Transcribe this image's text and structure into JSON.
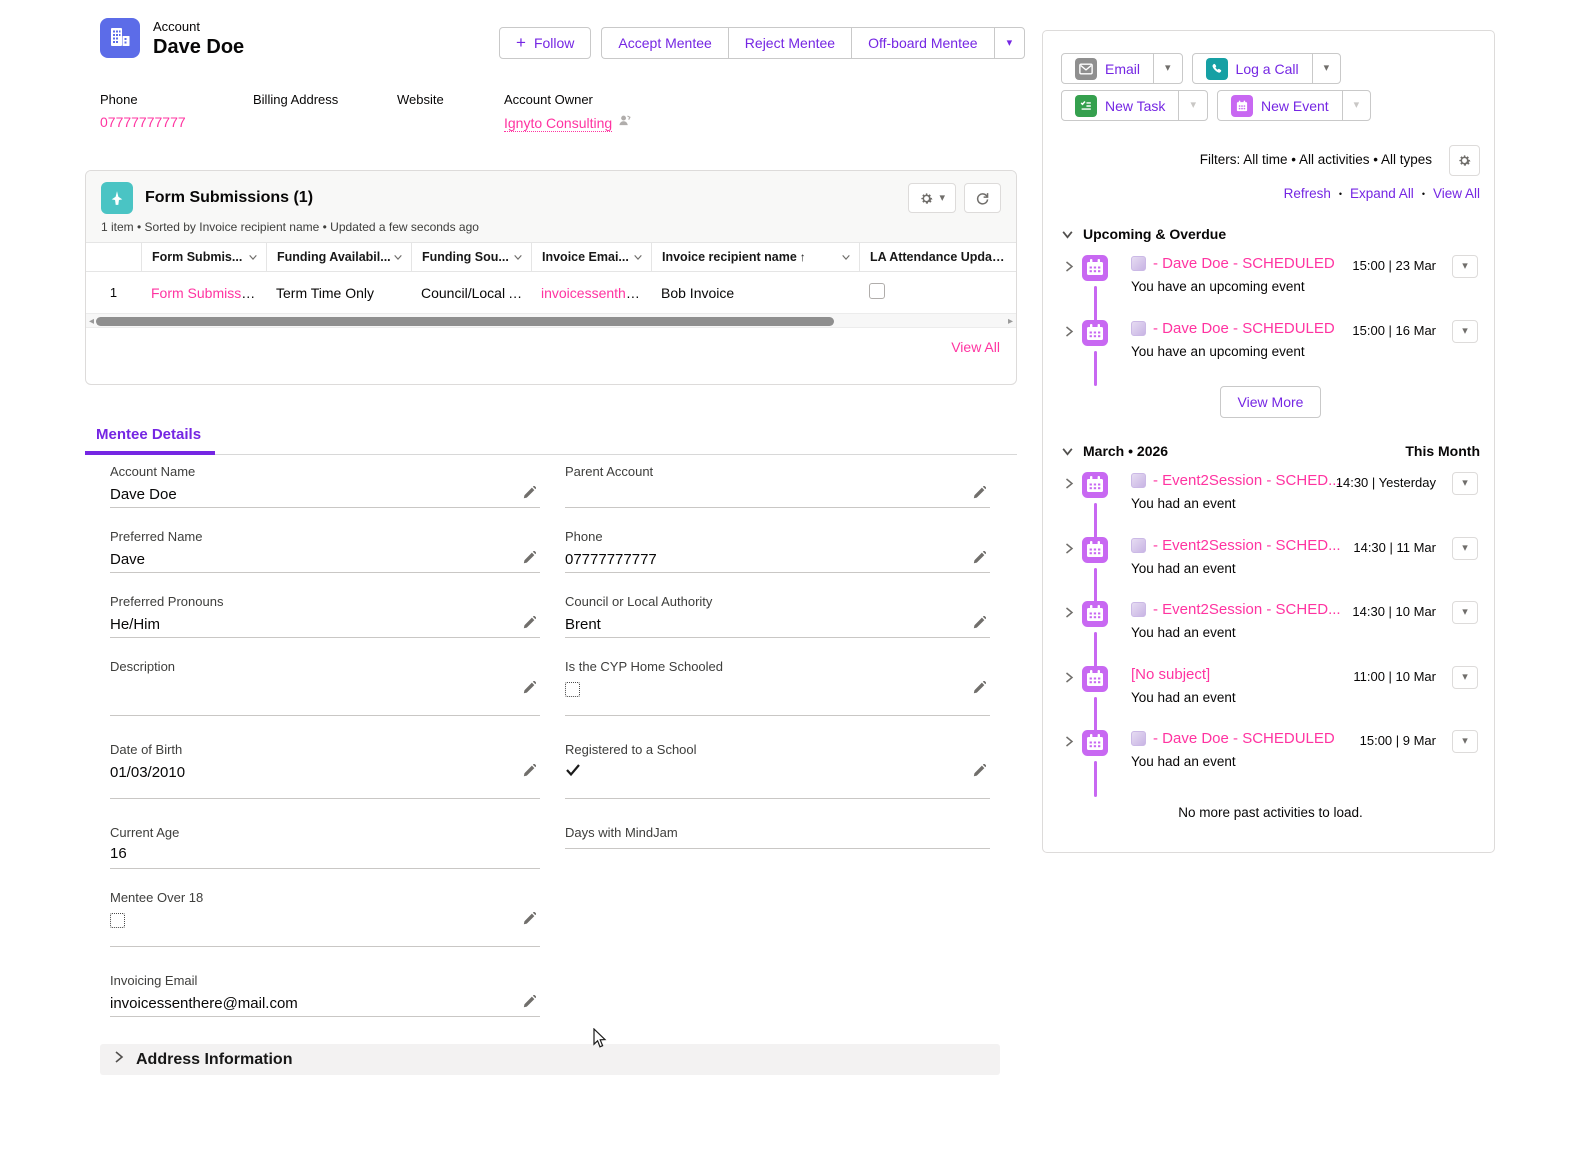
{
  "colors": {
    "accent_purple": "#7526E3",
    "link_pink": "#FF34A1",
    "account_icon_blue": "#5C6CE8",
    "form_icon_teal": "#4AC4C4",
    "event_icon_purple": "#C868F2",
    "task_icon_green": "#35A04E",
    "call_icon_teal": "#16A0A4",
    "email_icon_gray": "#8F8F8F"
  },
  "icons": {
    "plus": "+",
    "caret": "▾",
    "bullet": "•",
    "sort_asc": "↑",
    "scroll_left": "◂",
    "scroll_right": "▸"
  },
  "header": {
    "entity_label": "Account",
    "record_name": "Dave Doe",
    "follow_button": "Follow",
    "action_buttons": [
      "Accept Mentee",
      "Reject Mentee",
      "Off-board Mentee"
    ],
    "detail_fields": [
      {
        "label": "Phone",
        "value": "07777777777"
      },
      {
        "label": "Billing Address",
        "value": ""
      },
      {
        "label": "Website",
        "value": ""
      },
      {
        "label": "Account Owner",
        "value": "Ignyto Consulting"
      }
    ]
  },
  "related_list": {
    "title": "Form Submissions (1)",
    "subtitle": "1 item • Sorted by Invoice recipient name • Updated a few seconds ago",
    "columns": [
      {
        "label": "Form Submis..."
      },
      {
        "label": "Funding Availabil..."
      },
      {
        "label": "Funding Sou..."
      },
      {
        "label": "Invoice Emai..."
      },
      {
        "label": "Invoice recipient name",
        "sorted": "asc"
      },
      {
        "label": "LA Attendance Update..."
      }
    ],
    "row": {
      "index": "1",
      "form_submission": "Form Submissio...",
      "funding_availability": "Term Time Only",
      "funding_source": "Council/Local A...",
      "invoice_email": "invoicessenther...",
      "invoice_recipient": "Bob Invoice"
    },
    "view_all_label": "View All"
  },
  "details_tab": {
    "tab_label": "Mentee Details",
    "left_fields": [
      {
        "label": "Account Name",
        "value": "Dave Doe",
        "type": "text"
      },
      {
        "label": "Preferred Name",
        "value": "Dave",
        "type": "text"
      },
      {
        "label": "Preferred Pronouns",
        "value": "He/Him",
        "type": "text"
      },
      {
        "label": "Description",
        "value": "",
        "type": "empty"
      },
      {
        "label": "Date of Birth",
        "value": "01/03/2010",
        "type": "text"
      },
      {
        "label": "Current Age",
        "value": "16",
        "type": "text-readonly"
      },
      {
        "label": "Mentee Over 18",
        "type": "checkbox-unchecked"
      },
      {
        "label": "Invoicing Email",
        "value": "invoicessenthere@mail.com",
        "type": "link"
      }
    ],
    "right_fields": [
      {
        "label": "Parent Account",
        "value": "",
        "type": "empty"
      },
      {
        "label": "Phone",
        "value": "07777777777",
        "type": "link"
      },
      {
        "label": "Council or Local Authority",
        "value": "Brent",
        "type": "text"
      },
      {
        "label": "Is the CYP Home Schooled",
        "type": "checkbox-unchecked"
      },
      {
        "label": "Registered to a School",
        "type": "checkbox-checked"
      },
      {
        "label": "Days with MindJam",
        "value": "",
        "type": "empty-readonly"
      }
    ]
  },
  "address_section": {
    "title": "Address Information"
  },
  "activity_panel": {
    "buttons": {
      "email": "Email",
      "log_call": "Log a Call",
      "new_task": "New Task",
      "new_event": "New Event"
    },
    "filters_text": "Filters: All time • All activities • All types",
    "links": {
      "refresh": "Refresh",
      "expand_all": "Expand All",
      "view_all": "View All"
    },
    "upcoming": {
      "title": "Upcoming & Overdue",
      "items": [
        {
          "title": "- Dave Doe - SCHEDULED",
          "time": "15:00 | 23 Mar",
          "desc": "You have an upcoming event"
        },
        {
          "title": "- Dave Doe - SCHEDULED",
          "time": "15:00 | 16 Mar",
          "desc": "You have an upcoming event"
        }
      ],
      "view_more_label": "View More"
    },
    "month_section": {
      "title": "March • 2026",
      "badge": "This Month",
      "items": [
        {
          "title": "- Event2Session - SCHED...",
          "time": "14:30 | Yesterday",
          "desc": "You had an event"
        },
        {
          "title": "- Event2Session - SCHED...",
          "time": "14:30 | 11 Mar",
          "desc": "You had an event"
        },
        {
          "title": "- Event2Session - SCHED...",
          "time": "14:30 | 10 Mar",
          "desc": "You had an event"
        },
        {
          "title": "[No subject]",
          "time": "11:00 | 10 Mar",
          "desc": "You had an event"
        },
        {
          "title": "- Dave Doe - SCHEDULED",
          "time": "15:00 | 9 Mar",
          "desc": "You had an event"
        }
      ],
      "footer_text": "No more past activities to load."
    }
  }
}
